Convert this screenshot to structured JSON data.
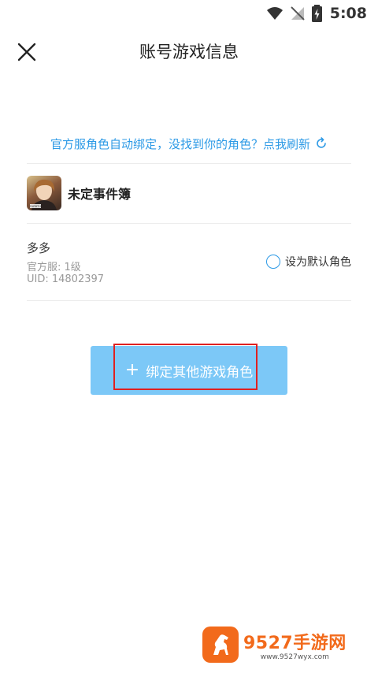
{
  "status_bar": {
    "time": "5:08"
  },
  "header": {
    "title": "账号游戏信息"
  },
  "notice": {
    "text": "官方服角色自动绑定，没找到你的角色？点我刷新"
  },
  "game": {
    "name": "未定事件簿",
    "avatar_caption": "FARBTH"
  },
  "role": {
    "name": "多多",
    "server": "官方服: 1级",
    "uid": "UID: 14802397",
    "default_label": "设为默认角色"
  },
  "bind_button": {
    "plus": "+",
    "label": "绑定其他游戏角色"
  },
  "watermark": {
    "main": "9527手游网",
    "sub": "www.9527wyx.com"
  },
  "colors": {
    "accent": "#2d9ae6",
    "button": "#7cc8f7",
    "highlight": "#e02020",
    "brand": "#f26a1b"
  }
}
